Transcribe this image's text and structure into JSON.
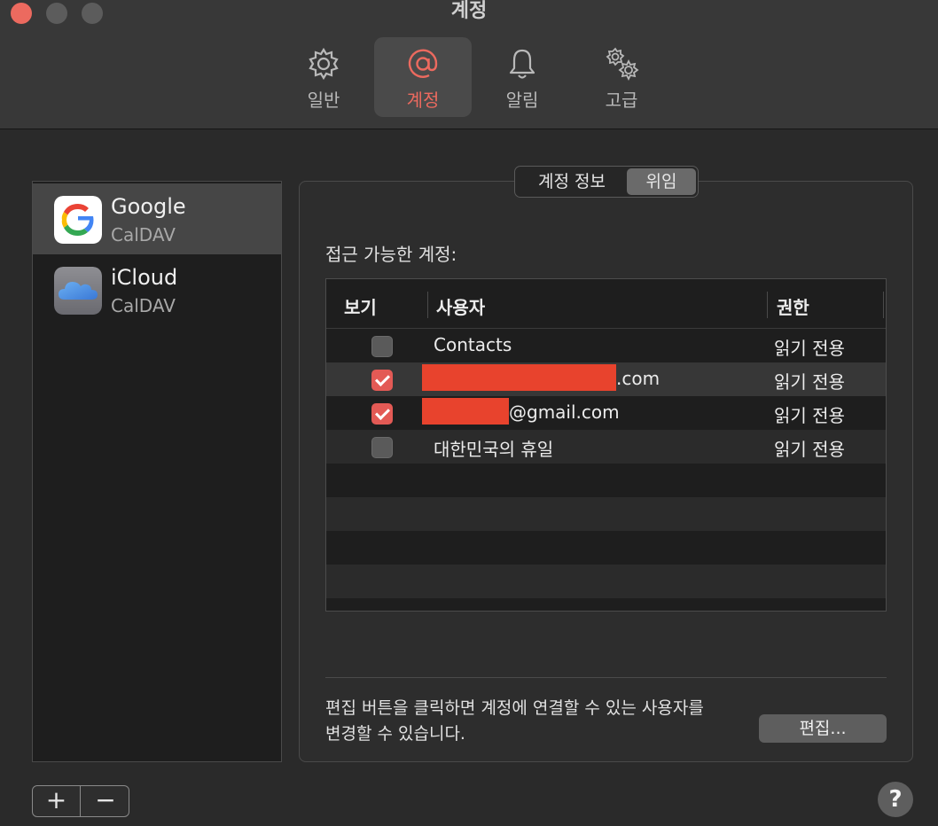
{
  "window": {
    "title": "계정"
  },
  "toolbar": {
    "tabs": [
      {
        "label": "일반",
        "icon": "gear-icon"
      },
      {
        "label": "계정",
        "icon": "at-sign-icon",
        "active": true
      },
      {
        "label": "알림",
        "icon": "bell-icon"
      },
      {
        "label": "고급",
        "icon": "gears-icon"
      }
    ]
  },
  "sidebar": {
    "accounts": [
      {
        "name": "Google",
        "type": "CalDAV",
        "selected": true,
        "icon": "google-logo-icon"
      },
      {
        "name": "iCloud",
        "type": "CalDAV",
        "selected": false,
        "icon": "icloud-logo-icon"
      }
    ],
    "add_label": "+",
    "remove_label": "−"
  },
  "segmented": {
    "options": [
      "계정 정보",
      "위임"
    ],
    "selected": "위임"
  },
  "access": {
    "label": "접근 가능한 계정:",
    "columns": [
      "보기",
      "사용자",
      "권한"
    ],
    "rows": [
      {
        "checked": false,
        "user": "Contacts",
        "permission": "읽기 전용"
      },
      {
        "checked": true,
        "user_suffix": ".com",
        "permission": "읽기 전용"
      },
      {
        "checked": true,
        "user_suffix": "@gmail.com",
        "permission": "읽기 전용"
      },
      {
        "checked": false,
        "user": "대한민국의 휴일",
        "permission": "읽기 전용"
      }
    ]
  },
  "footer": {
    "text_line1": "편집 버튼을 클릭하면 계정에 연결할 수 있는 사용자를",
    "text_line2": "변경할 수 있습니다.",
    "edit_label": "편집..."
  },
  "help_label": "?",
  "colors": {
    "accent": "#ec6a5f",
    "checkbox": "#e35a55",
    "redaction": "#e8432d"
  }
}
